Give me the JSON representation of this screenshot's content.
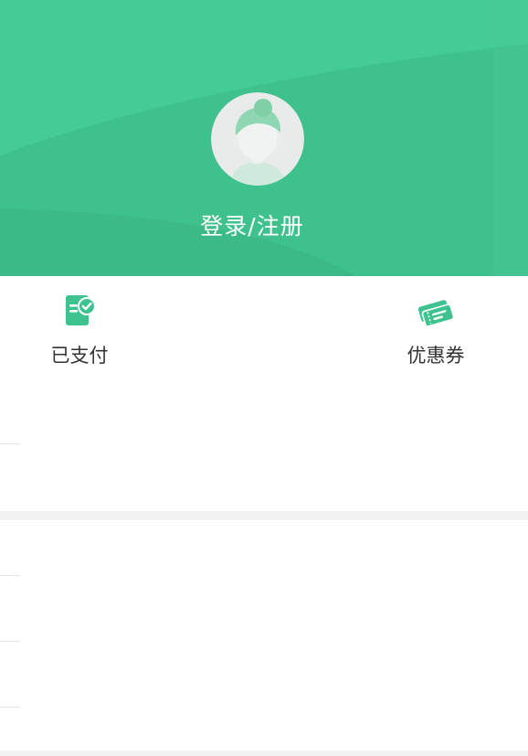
{
  "profile": {
    "login_label": "登录/注册"
  },
  "quick_actions": [
    {
      "label": "已支付",
      "icon": "paid-order-icon"
    },
    {
      "label": "优惠券",
      "icon": "coupon-icon"
    }
  ],
  "colors": {
    "header_green": "#43c993",
    "icon_green": "#3ec28f",
    "divider_gray": "#f2f2f2"
  }
}
